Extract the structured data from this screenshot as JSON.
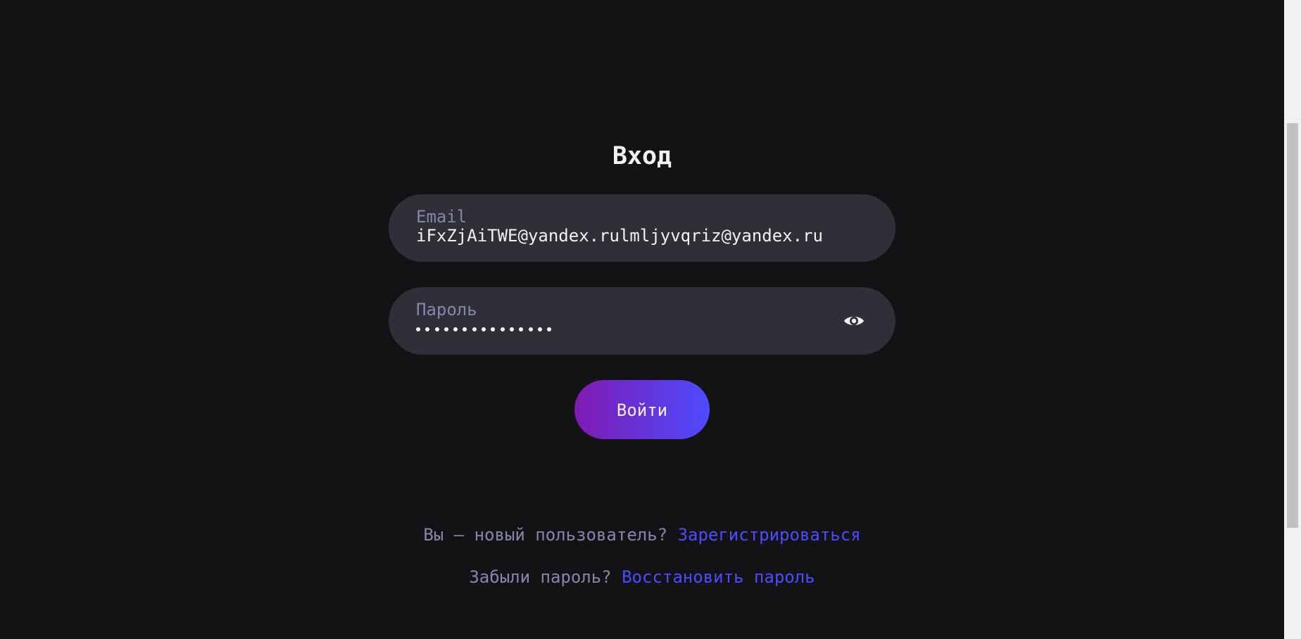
{
  "title": "Вход",
  "email": {
    "label": "Email",
    "value": "iFxZjAiTWE@yandex.rulmljyvqriz@yandex.ru"
  },
  "password": {
    "label": "Пароль",
    "masked_length": 15,
    "toggle_icon": "eye-icon"
  },
  "login_button": "Войти",
  "register": {
    "prompt": "Вы — новый пользователь?",
    "link": "Зарегистрироваться"
  },
  "restore": {
    "prompt": "Забыли пароль?",
    "link": "Восстановить пароль"
  },
  "colors": {
    "background": "#131316",
    "field": "#2f2f37",
    "label": "#8585ad",
    "text": "#f2f2f3",
    "link": "#4c4cff",
    "button_gradient_start": "#801ab2",
    "button_gradient_end": "#4c4cff"
  }
}
